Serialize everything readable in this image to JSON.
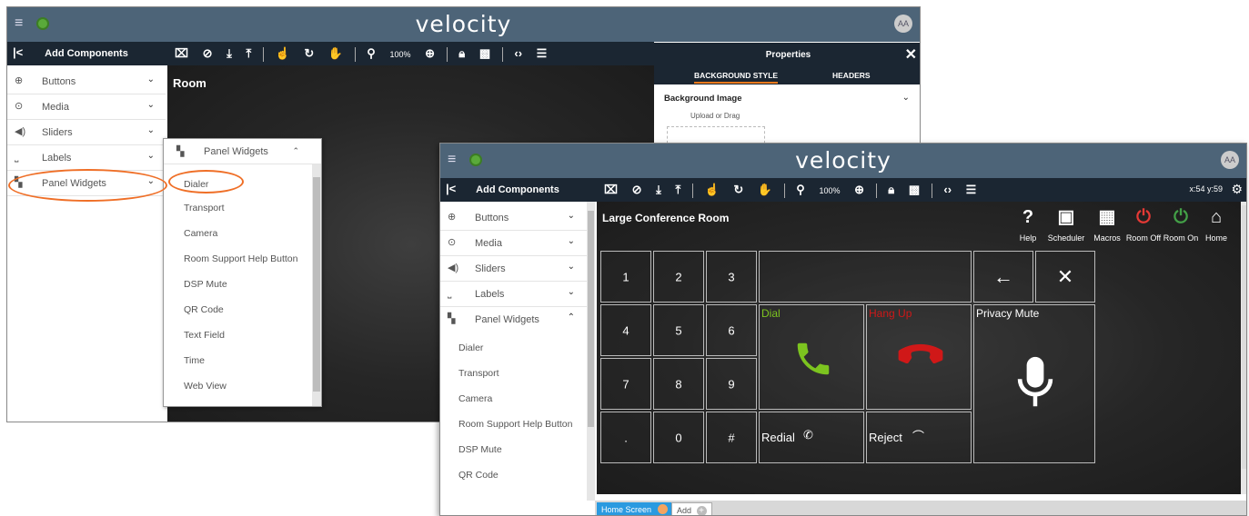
{
  "back": {
    "app_title": "velocity",
    "avatar": "AA",
    "left_panel_title": "Add Components",
    "collapse_glyph": "|<",
    "categories": [
      {
        "label": "Buttons",
        "icon": "plus-circle-icon"
      },
      {
        "label": "Media",
        "icon": "play-circle-icon"
      },
      {
        "label": "Sliders",
        "icon": "volume-icon"
      },
      {
        "label": "Labels",
        "icon": "label-icon"
      },
      {
        "label": "Panel Widgets",
        "icon": "grid-icon"
      }
    ],
    "canvas_title": "Room",
    "properties": {
      "title": "Properties",
      "close": "✕",
      "tabs": [
        "BACKGROUND STYLE",
        "HEADERS"
      ],
      "background_image_label": "Background Image",
      "upload_text": "Upload or Drag"
    },
    "dropdown": {
      "header": "Panel Widgets",
      "items": [
        "Dialer",
        "Transport",
        "Camera",
        "Room Support Help Button",
        "DSP Mute",
        "QR Code",
        "Text Field",
        "Time",
        "Web View"
      ]
    },
    "zoom": "100%"
  },
  "front": {
    "app_title": "velocity",
    "avatar": "AA",
    "left_panel_title": "Add Components",
    "collapse_glyph": "|<",
    "categories": [
      {
        "label": "Buttons",
        "icon": "plus-circle-icon"
      },
      {
        "label": "Media",
        "icon": "play-circle-icon"
      },
      {
        "label": "Sliders",
        "icon": "volume-icon"
      },
      {
        "label": "Labels",
        "icon": "label-icon"
      },
      {
        "label": "Panel Widgets",
        "icon": "grid-icon"
      }
    ],
    "sub_items": [
      "Dialer",
      "Transport",
      "Camera",
      "Room Support Help Button",
      "DSP Mute",
      "QR Code"
    ],
    "coords": "x:54 y:59",
    "zoom": "100%",
    "room_title": "Large Conference Room",
    "panel_buttons": [
      {
        "label": "Help",
        "glyph": "?",
        "color": "#ffffff"
      },
      {
        "label": "Scheduler",
        "glyph": "▣",
        "color": "#ffffff"
      },
      {
        "label": "Macros",
        "glyph": "▦",
        "color": "#ffffff"
      },
      {
        "label": "Room Off",
        "glyph": "⏻",
        "color": "#e53935"
      },
      {
        "label": "Room On",
        "glyph": "⏻",
        "color": "#43a047"
      },
      {
        "label": "Home",
        "glyph": "⌂",
        "color": "#ffffff"
      }
    ],
    "keypad": [
      "1",
      "2",
      "3",
      "4",
      "5",
      "6",
      "7",
      "8",
      "9",
      ".",
      "0",
      "#"
    ],
    "dial_label": "Dial",
    "hangup_label": "Hang Up",
    "privacy_label": "Privacy Mute",
    "redial_label": "Redial",
    "reject_label": "Reject",
    "backspace_glyph": "←",
    "clear_glyph": "✕",
    "bottom_tabs": [
      "Home Screen",
      "Add"
    ],
    "colors": {
      "dial": "#7cc41f",
      "hangup": "#d01818",
      "accent": "#f07a1c",
      "header": "#4d6478",
      "dark": "#1b2632"
    }
  }
}
